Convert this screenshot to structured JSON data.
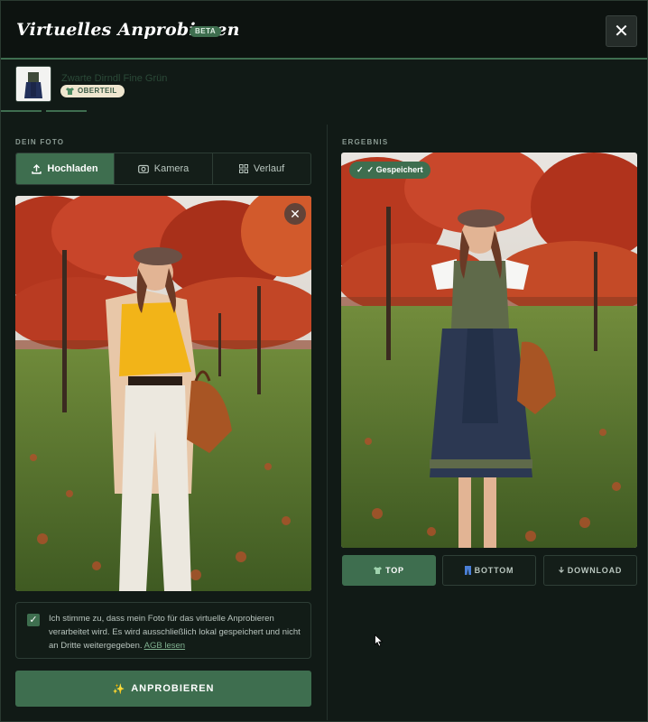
{
  "header": {
    "title": "Virtuelles Anprobieren",
    "badge": "BETA",
    "close_label": "✕"
  },
  "product": {
    "name": "Zwarte Dirndl Fine Grün",
    "tag_icon": "shirt-icon",
    "tag": "OBERTEIL"
  },
  "photo_panel": {
    "section_label": "DEIN FOTO",
    "tabs": [
      {
        "label": "Hochladen",
        "icon": "upload-icon",
        "active": true
      },
      {
        "label": "Kamera",
        "icon": "camera-icon",
        "active": false
      },
      {
        "label": "Verlauf",
        "icon": "grid-icon",
        "active": false
      }
    ],
    "remove_label": "✕",
    "consent": {
      "checked": true,
      "text": "Ich stimme zu, dass mein Foto für das virtuelle Anprobieren verarbeitet wird. Es wird ausschließlich lokal gespeichert und nicht an Dritte weitergegeben.",
      "link": "AGB lesen"
    },
    "try_button": "ANPROBIEREN",
    "try_icon": "✨"
  },
  "result_panel": {
    "section_label": "ERGEBNIS",
    "saved_badge": "✓ Gespeichert",
    "saved_icon": "✓",
    "actions": [
      {
        "label": "TOP",
        "icon": "shirt-icon",
        "active": true
      },
      {
        "label": "BOTTOM",
        "icon": "pants-icon",
        "active": false
      },
      {
        "label": "DOWNLOAD",
        "icon": "download-icon",
        "active": false
      }
    ]
  },
  "colors": {
    "accent": "#3e6e4f",
    "background": "#111a16",
    "header": "#0d1310"
  }
}
